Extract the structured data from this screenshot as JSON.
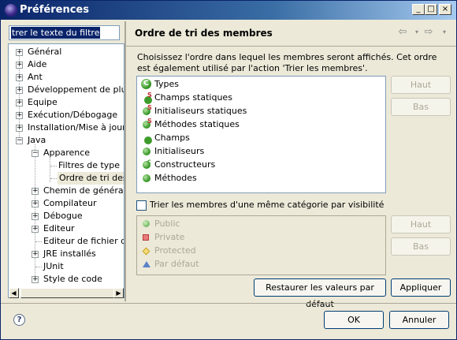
{
  "window": {
    "title": "Préférences",
    "buttons": {
      "minimize": "_",
      "maximize": "□",
      "close": "×"
    }
  },
  "filter": {
    "value": "trer le texte du filtre"
  },
  "tree": {
    "items": [
      {
        "label": "Général",
        "twisty": "+",
        "level": 0
      },
      {
        "label": "Aide",
        "twisty": "+",
        "level": 0
      },
      {
        "label": "Ant",
        "twisty": "+",
        "level": 0
      },
      {
        "label": "Développement de plug-i",
        "twisty": "+",
        "level": 0
      },
      {
        "label": "Equipe",
        "twisty": "+",
        "level": 0
      },
      {
        "label": "Exécution/Débogage",
        "twisty": "+",
        "level": 0
      },
      {
        "label": "Installation/Mise à jour",
        "twisty": "+",
        "level": 0
      },
      {
        "label": "Java",
        "twisty": "−",
        "level": 0
      },
      {
        "label": "Apparence",
        "twisty": "−",
        "level": 1
      },
      {
        "label": "Filtres de type",
        "twisty": "",
        "level": 2
      },
      {
        "label": "Ordre de tri des r",
        "twisty": "",
        "level": 2,
        "selected": true
      },
      {
        "label": "Chemin de génération",
        "twisty": "+",
        "level": 1
      },
      {
        "label": "Compilateur",
        "twisty": "+",
        "level": 1
      },
      {
        "label": "Débogue",
        "twisty": "+",
        "level": 1
      },
      {
        "label": "Editeur",
        "twisty": "+",
        "level": 1
      },
      {
        "label": "Editeur de fichier de p",
        "twisty": "",
        "level": 1
      },
      {
        "label": "JRE installés",
        "twisty": "+",
        "level": 1
      },
      {
        "label": "JUnit",
        "twisty": "",
        "level": 1
      },
      {
        "label": "Style de code",
        "twisty": "+",
        "level": 1
      }
    ]
  },
  "page": {
    "title": "Ordre de tri des membres",
    "description": "Choisissez l'ordre dans lequel les membres seront affichés. Cet ordre est également utilisé par l'action 'Trier les membres'.",
    "members": [
      {
        "label": "Types",
        "icon": "type-icon"
      },
      {
        "label": "Champs statiques",
        "icon": "static-field-icon"
      },
      {
        "label": "Initialiseurs statiques",
        "icon": "static-initializer-icon"
      },
      {
        "label": "Méthodes statiques",
        "icon": "static-method-icon"
      },
      {
        "label": "Champs",
        "icon": "field-icon"
      },
      {
        "label": "Initialiseurs",
        "icon": "initializer-icon"
      },
      {
        "label": "Constructeurs",
        "icon": "constructor-icon"
      },
      {
        "label": "Méthodes",
        "icon": "method-icon"
      }
    ],
    "up_label": "Haut",
    "down_label": "Bas",
    "sort_by_visibility_label": "Trier les membres d'une même catégorie par visibilité",
    "visibility": [
      {
        "label": "Public",
        "icon": "public-icon"
      },
      {
        "label": "Private",
        "icon": "private-icon"
      },
      {
        "label": "Protected",
        "icon": "protected-icon"
      },
      {
        "label": "Par défaut",
        "icon": "default-icon"
      }
    ],
    "restore_defaults_label": "Restaurer les valeurs par défaut",
    "apply_label": "Appliquer"
  },
  "footer": {
    "ok_label": "OK",
    "cancel_label": "Annuler"
  },
  "colors": {
    "title_bar": "#0a246a",
    "member_icon_green": "#3d9b2c",
    "static_marker": "#c0282d",
    "private_red": "#d94848",
    "protected_yellow": "#e8c53a",
    "default_blue": "#3a64b8"
  }
}
